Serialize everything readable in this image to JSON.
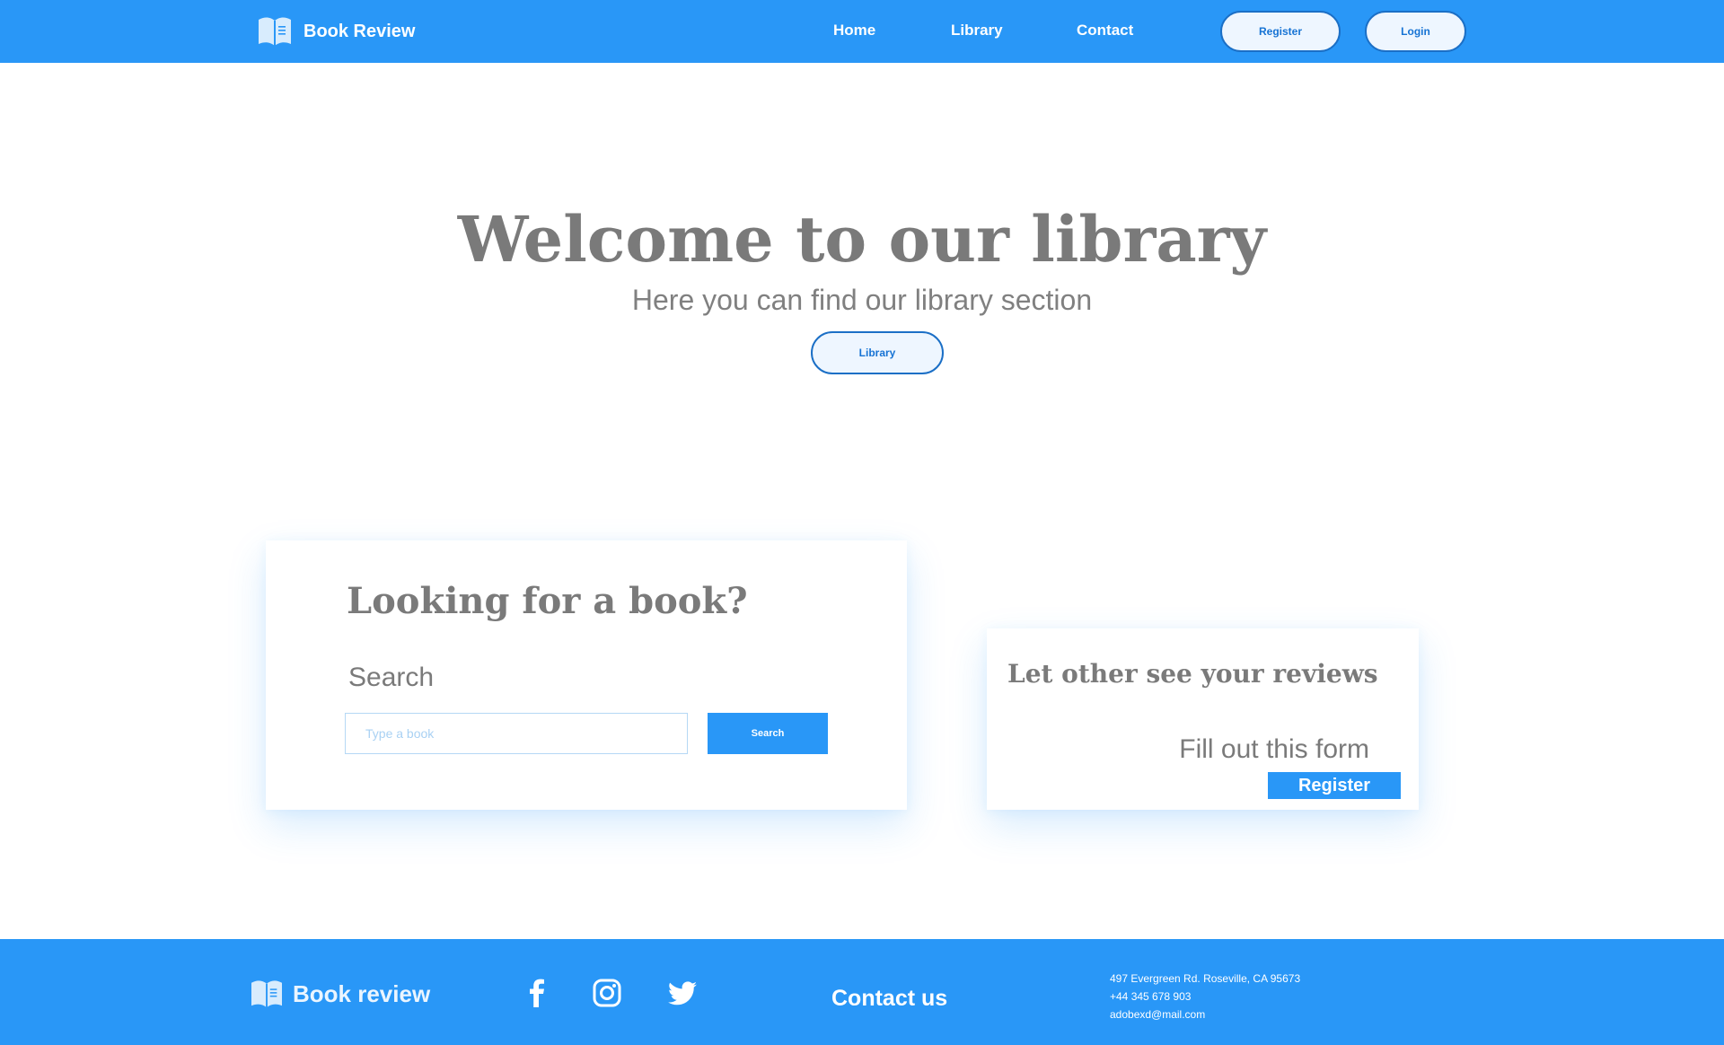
{
  "header": {
    "brand": "Book Review",
    "nav": [
      "Home",
      "Library",
      "Contact"
    ],
    "register_label": "Register",
    "login_label": "Login"
  },
  "hero": {
    "title": "Welcome to our library",
    "subtitle": "Here you can find our library section",
    "button_label": "Library"
  },
  "search_card": {
    "title": "Looking for a book?",
    "label": "Search",
    "input_placeholder": "Type a book",
    "input_value": "",
    "button_label": "Search"
  },
  "review_card": {
    "title": "Let other see your reviews",
    "subtitle": "Fill out this form",
    "button_label": "Register"
  },
  "footer": {
    "brand": "Book review",
    "social_icons": [
      "facebook-icon",
      "instagram-icon",
      "twitter-icon"
    ],
    "contact_heading": "Contact us",
    "address": "497 Evergreen Rd. Roseville, CA 95673",
    "phone": "+44 345 678 903",
    "email": "adobexd@mail.com"
  },
  "colors": {
    "primary": "#2997f7",
    "button_border": "#1b6fc6",
    "button_text": "#1673d4",
    "heading_gray": "#7a7a7a",
    "pill_background": "#eef6ff"
  }
}
